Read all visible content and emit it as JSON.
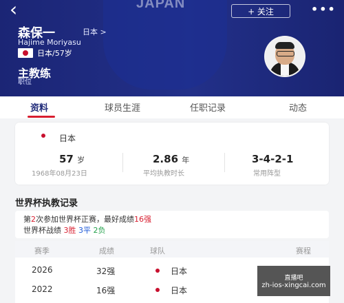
{
  "header": {
    "crest_text": "JAPAN",
    "back_icon": "back-arrow-icon",
    "follow_label": "+ 关注",
    "more_label": "•••",
    "name": "森保一",
    "country_link": "日本 >",
    "name_en": "Hajime Moriyasu",
    "nationality_age": "日本/57岁",
    "role": "主教练",
    "role_label": "职位"
  },
  "tabs": [
    {
      "label": "资料"
    },
    {
      "label": "球员生涯"
    },
    {
      "label": "任职记录"
    },
    {
      "label": "动态"
    }
  ],
  "stats": {
    "country": "日本",
    "items": [
      {
        "num": "57",
        "unit": "岁",
        "label": "1968年08月23日"
      },
      {
        "num": "2.86",
        "unit": "年",
        "label": "平均执教时长"
      },
      {
        "num": "3-4-2-1",
        "unit": "",
        "label": "常用阵型"
      }
    ]
  },
  "world_cup": {
    "title": "世界杯执教记录",
    "line1": {
      "p1": "第",
      "n1": "2",
      "p2": "次参加世界杯正赛，最好成绩",
      "best": "16强"
    },
    "line2": {
      "p1": "世界杯战绩 ",
      "wins": "3胜",
      "draws": "3平",
      "losses": "2负",
      "sp": " "
    },
    "columns": [
      "赛季",
      "成绩",
      "球队",
      "赛程"
    ],
    "rows": [
      {
        "season": "2026",
        "result": "32强",
        "team": "日本",
        "link": "查看"
      },
      {
        "season": "2022",
        "result": "16强",
        "team": "日本",
        "link": "查看"
      }
    ]
  },
  "overlay": {
    "line1": "直播吧",
    "line2": "zh-ios-xingcai.com"
  },
  "colors": {
    "header_blue": "#1f2a79",
    "accent_red": "#d81e2f",
    "win_red": "#d81e2f",
    "draw_blue": "#1f5bd8",
    "loss_green": "#22a04a"
  }
}
